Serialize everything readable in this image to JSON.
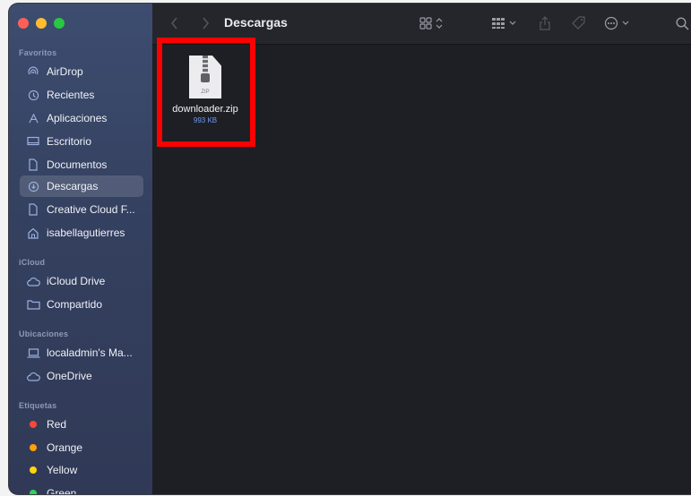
{
  "window": {
    "traffic_colors": [
      "#ff5f57",
      "#febc2e",
      "#28c840"
    ]
  },
  "toolbar": {
    "back_icon": "chevron-left-icon",
    "forward_icon": "chevron-right-icon",
    "title": "Descargas",
    "view_icon": "grid-view-icon",
    "group_icon": "group-by-icon",
    "share_icon": "share-icon",
    "tag_icon": "tag-icon",
    "more_icon": "more-icon",
    "search_icon": "search-icon"
  },
  "sidebar": {
    "favorites_label": "Favoritos",
    "favorites": [
      {
        "label": "AirDrop",
        "icon": "airdrop-icon"
      },
      {
        "label": "Recientes",
        "icon": "clock-icon"
      },
      {
        "label": "Aplicaciones",
        "icon": "applications-icon"
      },
      {
        "label": "Escritorio",
        "icon": "desktop-icon"
      },
      {
        "label": "Documentos",
        "icon": "document-icon"
      },
      {
        "label": "Descargas",
        "icon": "download-icon",
        "active": true
      },
      {
        "label": "Creative Cloud F...",
        "icon": "file-icon"
      },
      {
        "label": "isabellagutierres",
        "icon": "home-icon"
      }
    ],
    "icloud_label": "iCloud",
    "icloud": [
      {
        "label": "iCloud Drive",
        "icon": "cloud-icon"
      },
      {
        "label": "Compartido",
        "icon": "shared-folder-icon"
      }
    ],
    "locations_label": "Ubicaciones",
    "locations": [
      {
        "label": "localadmin's Ma...",
        "icon": "laptop-icon"
      },
      {
        "label": "OneDrive",
        "icon": "cloud-icon"
      }
    ],
    "tags_label": "Etiquetas",
    "tags": [
      {
        "label": "Red",
        "color": "#ff453a"
      },
      {
        "label": "Orange",
        "color": "#ff9f0a"
      },
      {
        "label": "Yellow",
        "color": "#ffd60a"
      },
      {
        "label": "Green",
        "color": "#30d158"
      }
    ]
  },
  "files": [
    {
      "name": "downloader.zip",
      "size": "993 KB",
      "ext": "ZIP",
      "icon": "zip-file-icon"
    }
  ],
  "annotation": {
    "color": "#ff0000"
  }
}
